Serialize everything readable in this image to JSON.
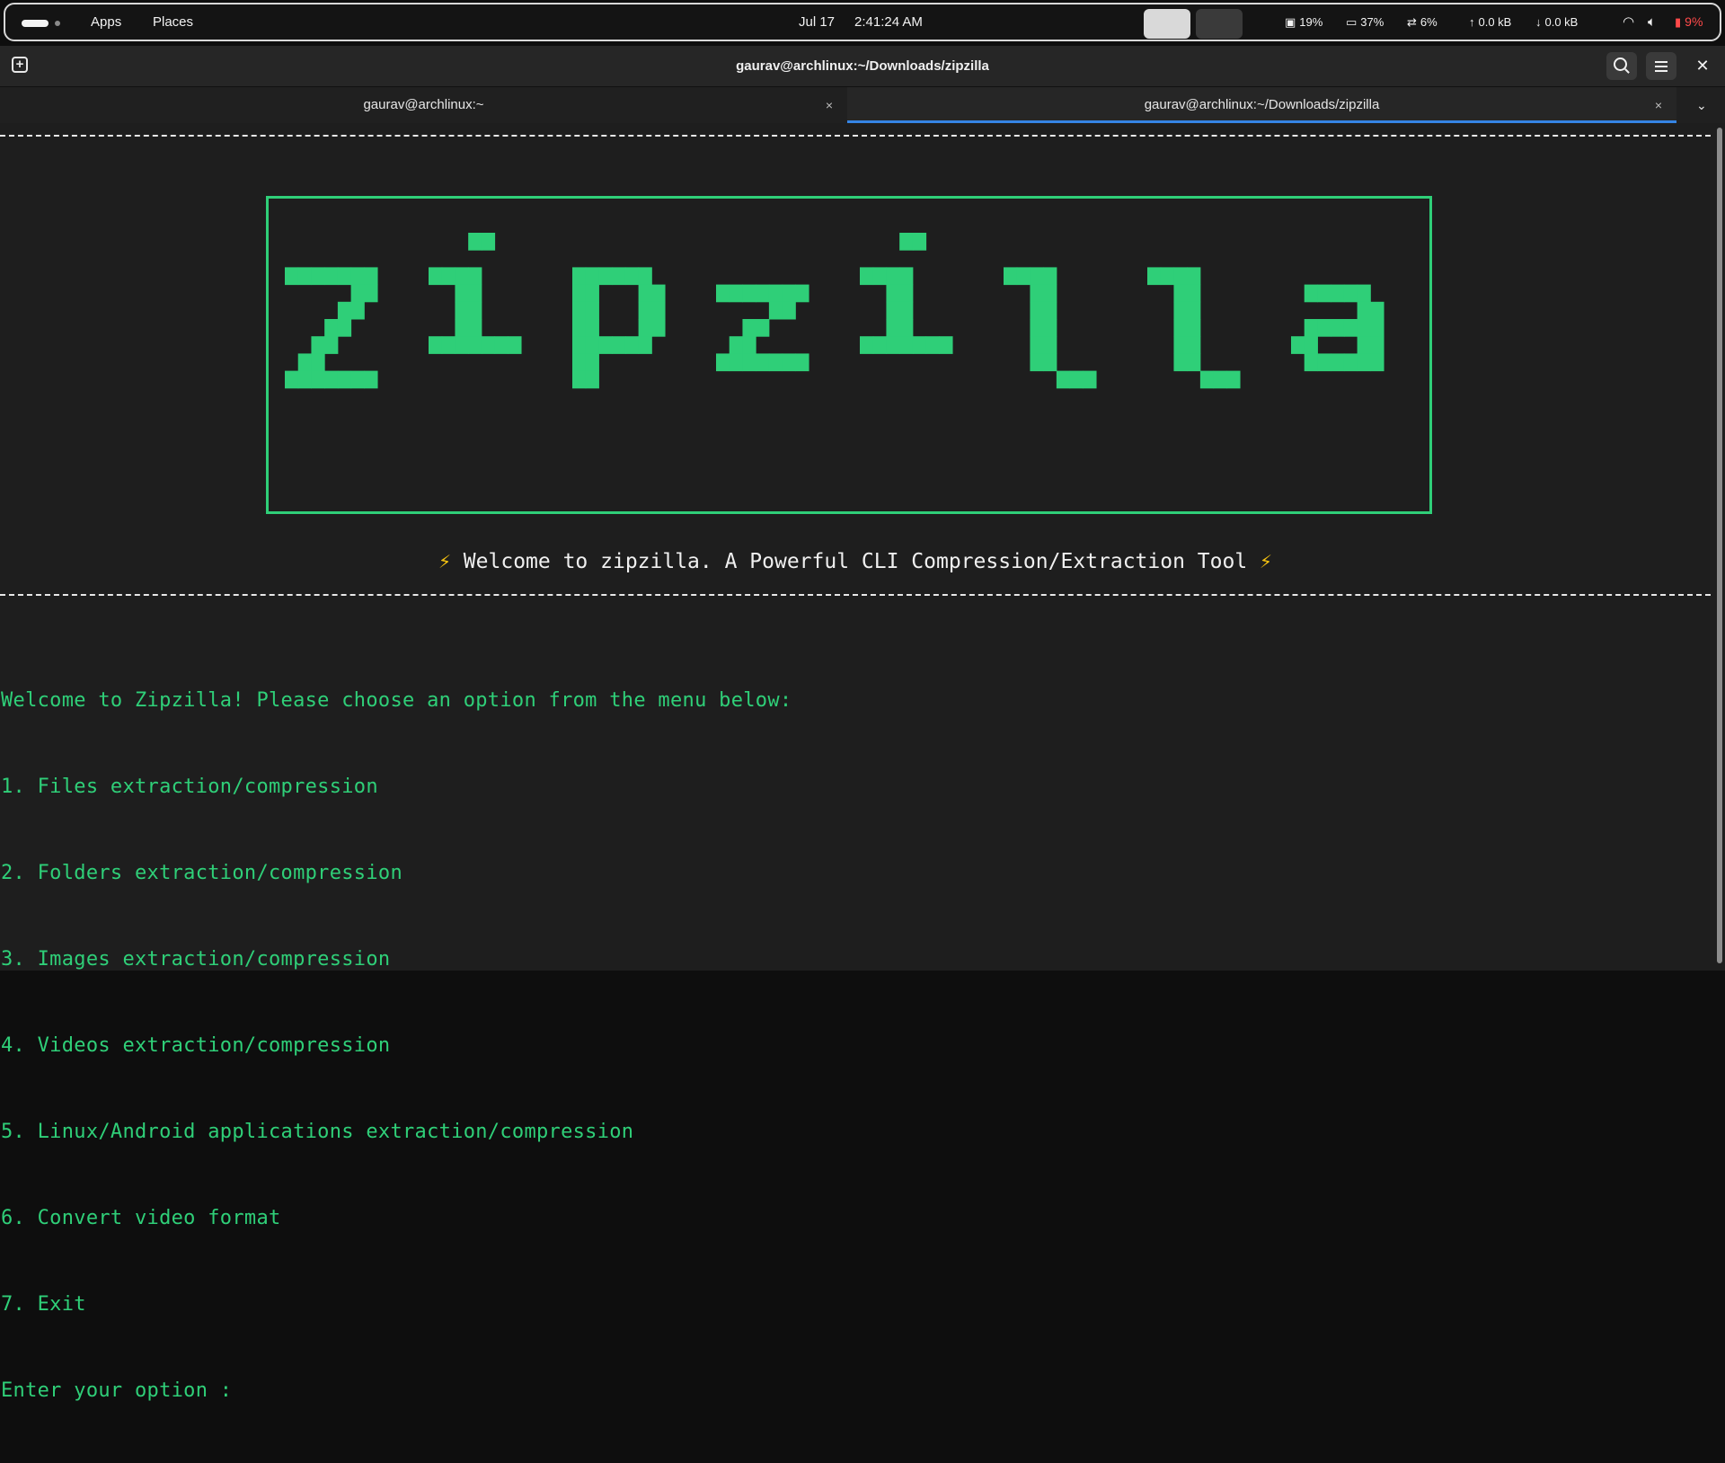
{
  "topbar": {
    "apps_label": "Apps",
    "places_label": "Places",
    "date": "Jul 17",
    "time": "2:41:24 AM",
    "cpu": "19%",
    "memory": "37%",
    "swap": "6%",
    "upload": "0.0 kB",
    "download": "0.0 kB",
    "battery": "9%"
  },
  "window": {
    "title": "gaurav@archlinux:~/Downloads/zipzilla"
  },
  "tabs": [
    {
      "label": "gaurav@archlinux:~",
      "close": "×"
    },
    {
      "label": "gaurav@archlinux:~/Downloads/zipzilla",
      "close": "×"
    }
  ],
  "terminal": {
    "logo_text": "Zipzilla",
    "banner_text": " Welcome to zipzilla. A Powerful CLI Compression/Extraction Tool ",
    "bolt": "⚡",
    "menu_lines": [
      "Welcome to Zipzilla! Please choose an option from the menu below:",
      "1. Files extraction/compression",
      "2. Folders extraction/compression",
      "3. Images extraction/compression",
      "4. Videos extraction/compression",
      "5. Linux/Android applications extraction/compression",
      "6. Convert video format",
      "7. Exit",
      "Enter your option :"
    ]
  },
  "colors": {
    "terminal_green": "#2fcf78",
    "accent_blue": "#3584e4",
    "battery_red": "#ff4a4a",
    "bolt_yellow": "#f5c211"
  }
}
